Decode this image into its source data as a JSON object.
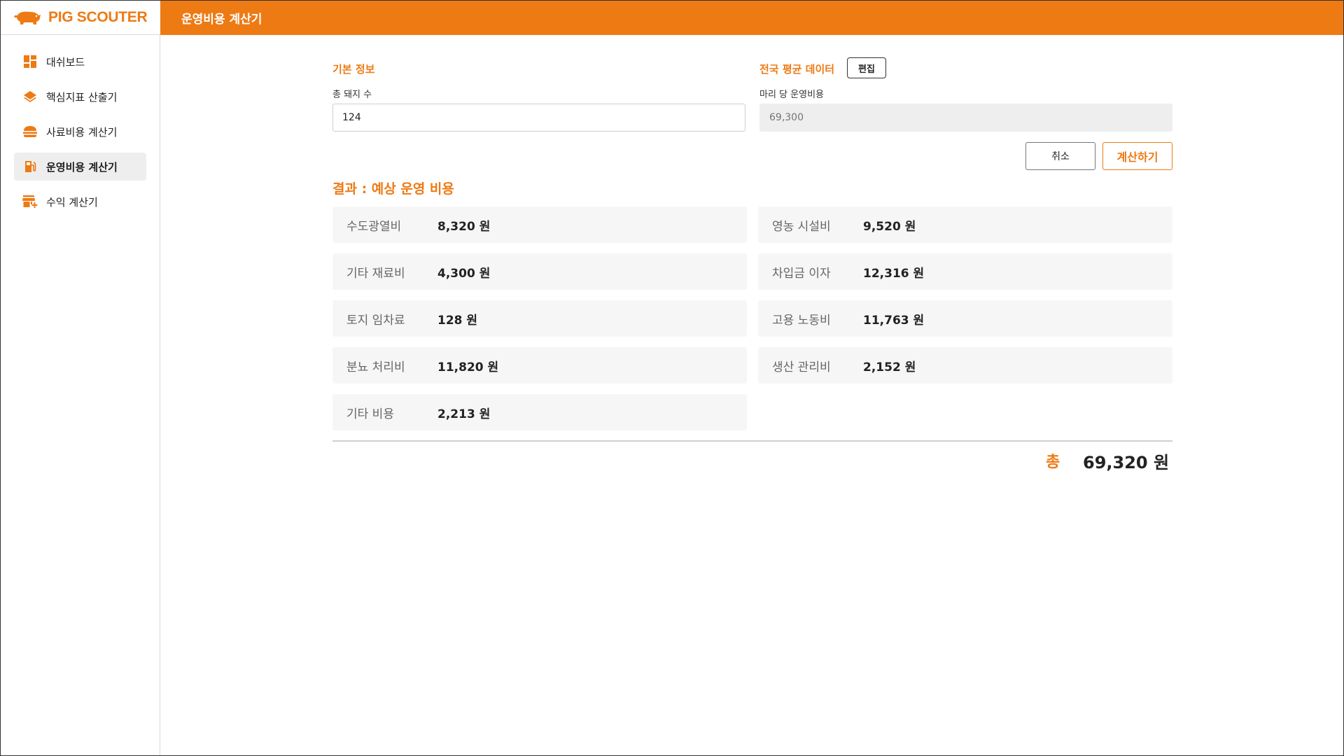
{
  "app": {
    "brand": "PIG SCOUTER",
    "page_title": "운영비용 계산기"
  },
  "colors": {
    "accent": "#ee7a14",
    "card_bg": "#f6f6f6",
    "active_nav_bg": "#eeeeee"
  },
  "sidebar": {
    "items": [
      {
        "label": "대쉬보드",
        "icon": "dashboard-icon",
        "active": false
      },
      {
        "label": "핵심지표 산출기",
        "icon": "layers-icon",
        "active": false
      },
      {
        "label": "사료비용 계산기",
        "icon": "feed-icon",
        "active": false
      },
      {
        "label": "운영비용 계산기",
        "icon": "fuel-pump-icon",
        "active": true
      },
      {
        "label": "수익 계산기",
        "icon": "store-add-icon",
        "active": false
      }
    ]
  },
  "basic_info": {
    "title": "기본 정보",
    "pig_count_label": "총 돼지 수",
    "pig_count_value": "124"
  },
  "national_avg": {
    "title": "전국 평균 데이터",
    "edit_label": "편집",
    "cost_per_head_label": "마리 당 운영비용",
    "cost_per_head_placeholder": "69,300"
  },
  "actions": {
    "cancel_label": "취소",
    "calculate_label": "계산하기"
  },
  "results": {
    "title": "결과 : 예상 운영 비용",
    "items": [
      {
        "name": "수도광열비",
        "value": "8,320 원"
      },
      {
        "name": "영농 시설비",
        "value": "9,520 원"
      },
      {
        "name": "기타 재료비",
        "value": "4,300 원"
      },
      {
        "name": "차입금 이자",
        "value": "12,316 원"
      },
      {
        "name": "토지 임차료",
        "value": "128 원"
      },
      {
        "name": "고용 노동비",
        "value": "11,763 원"
      },
      {
        "name": "분뇨 처리비",
        "value": "11,820 원"
      },
      {
        "name": "생산 관리비",
        "value": "2,152 원"
      },
      {
        "name": "기타 비용",
        "value": "2,213 원"
      }
    ],
    "total_label": "총",
    "total_value": "69,320 원"
  }
}
